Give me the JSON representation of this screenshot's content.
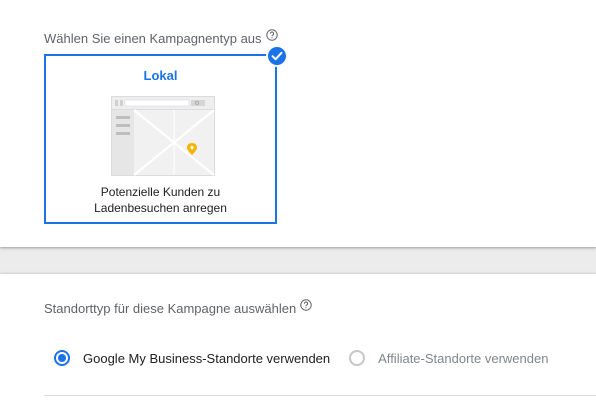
{
  "campaign_type_section": {
    "label": "Wählen Sie einen Kampagnentyp aus",
    "help_icon": "help-circle-icon",
    "selected_tile": {
      "title": "Lokal",
      "description_line1": "Potenzielle Kunden zu",
      "description_line2": "Ladenbesuchen anregen",
      "illustration": "map-browser-illustration",
      "selected": true,
      "badge_icon": "check-circle-icon"
    }
  },
  "location_type_section": {
    "label": "Standorttyp für diese Kampagne auswählen",
    "help_icon": "help-circle-icon",
    "options": [
      {
        "label": "Google My Business-Standorte verwenden",
        "selected": true
      },
      {
        "label": "Affiliate-Standorte verwenden",
        "selected": false
      }
    ]
  },
  "colors": {
    "accent": "#1a73e8",
    "pin": "#f4b400",
    "text_primary": "#202124",
    "text_secondary": "#5f6368"
  }
}
